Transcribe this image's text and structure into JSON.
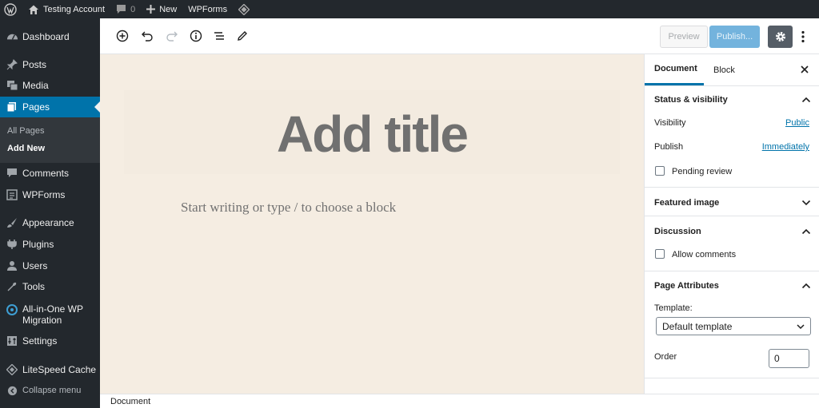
{
  "admin_bar": {
    "site_name": "Testing Account",
    "comments_count": "0",
    "new_label": "New",
    "wpforms_label": "WPForms"
  },
  "admin_menu": {
    "items": [
      {
        "label": "Dashboard",
        "icon": "dashboard-icon"
      },
      {
        "label": "Posts",
        "icon": "pin-icon"
      },
      {
        "label": "Media",
        "icon": "media-icon"
      },
      {
        "label": "Pages",
        "icon": "pages-icon"
      },
      {
        "label": "Comments",
        "icon": "comment-icon"
      },
      {
        "label": "WPForms",
        "icon": "form-icon"
      },
      {
        "label": "Appearance",
        "icon": "brush-icon"
      },
      {
        "label": "Plugins",
        "icon": "plug-icon"
      },
      {
        "label": "Users",
        "icon": "user-icon"
      },
      {
        "label": "Tools",
        "icon": "wrench-icon"
      },
      {
        "label": "All-in-One WP Migration",
        "icon": "migration-icon"
      },
      {
        "label": "Settings",
        "icon": "settings-icon"
      },
      {
        "label": "LiteSpeed Cache",
        "icon": "diamond-icon"
      },
      {
        "label": "Collapse menu",
        "icon": "collapse-icon"
      }
    ],
    "submenu": [
      {
        "label": "All Pages"
      },
      {
        "label": "Add New"
      }
    ]
  },
  "toolbar": {
    "preview_label": "Preview",
    "publish_label": "Publish..."
  },
  "canvas": {
    "title_placeholder": "Add title",
    "body_placeholder": "Start writing or type / to choose a block"
  },
  "sidebar": {
    "tabs": [
      {
        "label": "Document"
      },
      {
        "label": "Block"
      }
    ],
    "status_visibility": {
      "heading": "Status & visibility",
      "visibility_label": "Visibility",
      "visibility_value": "Public",
      "publish_label": "Publish",
      "publish_value": "Immediately",
      "pending_label": "Pending review"
    },
    "featured_image": {
      "heading": "Featured image"
    },
    "discussion": {
      "heading": "Discussion",
      "allow_comments_label": "Allow comments"
    },
    "page_attributes": {
      "heading": "Page Attributes",
      "template_label": "Template:",
      "template_value": "Default template",
      "order_label": "Order",
      "order_value": "0"
    }
  },
  "footer": {
    "breadcrumb": "Document"
  },
  "colors": {
    "admin_dark": "#23282d",
    "accent": "#0073aa",
    "canvas_bg": "#f5ede2"
  }
}
